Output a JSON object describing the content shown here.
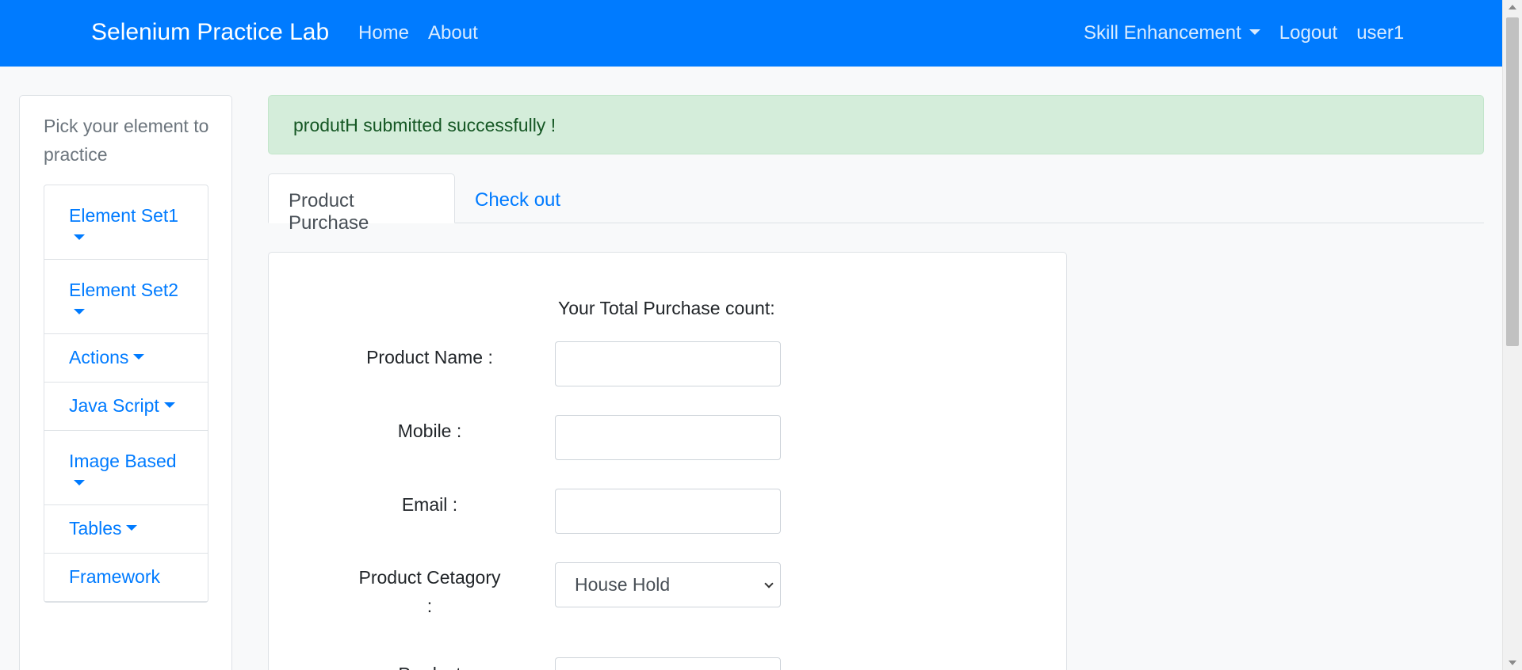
{
  "navbar": {
    "brand": "Selenium Practice Lab",
    "links": [
      "Home",
      "About"
    ],
    "right": {
      "dropdown": "Skill Enhancement",
      "logout": "Logout",
      "user": "user1"
    }
  },
  "sidebar": {
    "title": "Pick your element to practice",
    "items": [
      {
        "label": "Element Set1"
      },
      {
        "label": "Element Set2"
      },
      {
        "label": "Actions"
      },
      {
        "label": "Java Script"
      },
      {
        "label": "Image Based"
      },
      {
        "label": "Tables"
      },
      {
        "label": "Framework"
      }
    ]
  },
  "alert": {
    "message": "produtH submitted successfully !"
  },
  "tabs": [
    {
      "label": "Product Purchase",
      "active": true
    },
    {
      "label": "Check out",
      "active": false
    }
  ],
  "form": {
    "count_label": "Your Total Purchase count:",
    "count_value": "",
    "fields": {
      "product_name": {
        "label": "Product Name :",
        "value": ""
      },
      "mobile": {
        "label": "Mobile :",
        "value": ""
      },
      "email": {
        "label": "Email :",
        "value": ""
      },
      "category": {
        "label": "Product Cetagory :",
        "selected": "House Hold"
      },
      "next": {
        "label": "Product"
      }
    }
  },
  "colors": {
    "primary": "#007bff",
    "alert_bg": "#d4edda",
    "alert_text": "#155724"
  }
}
